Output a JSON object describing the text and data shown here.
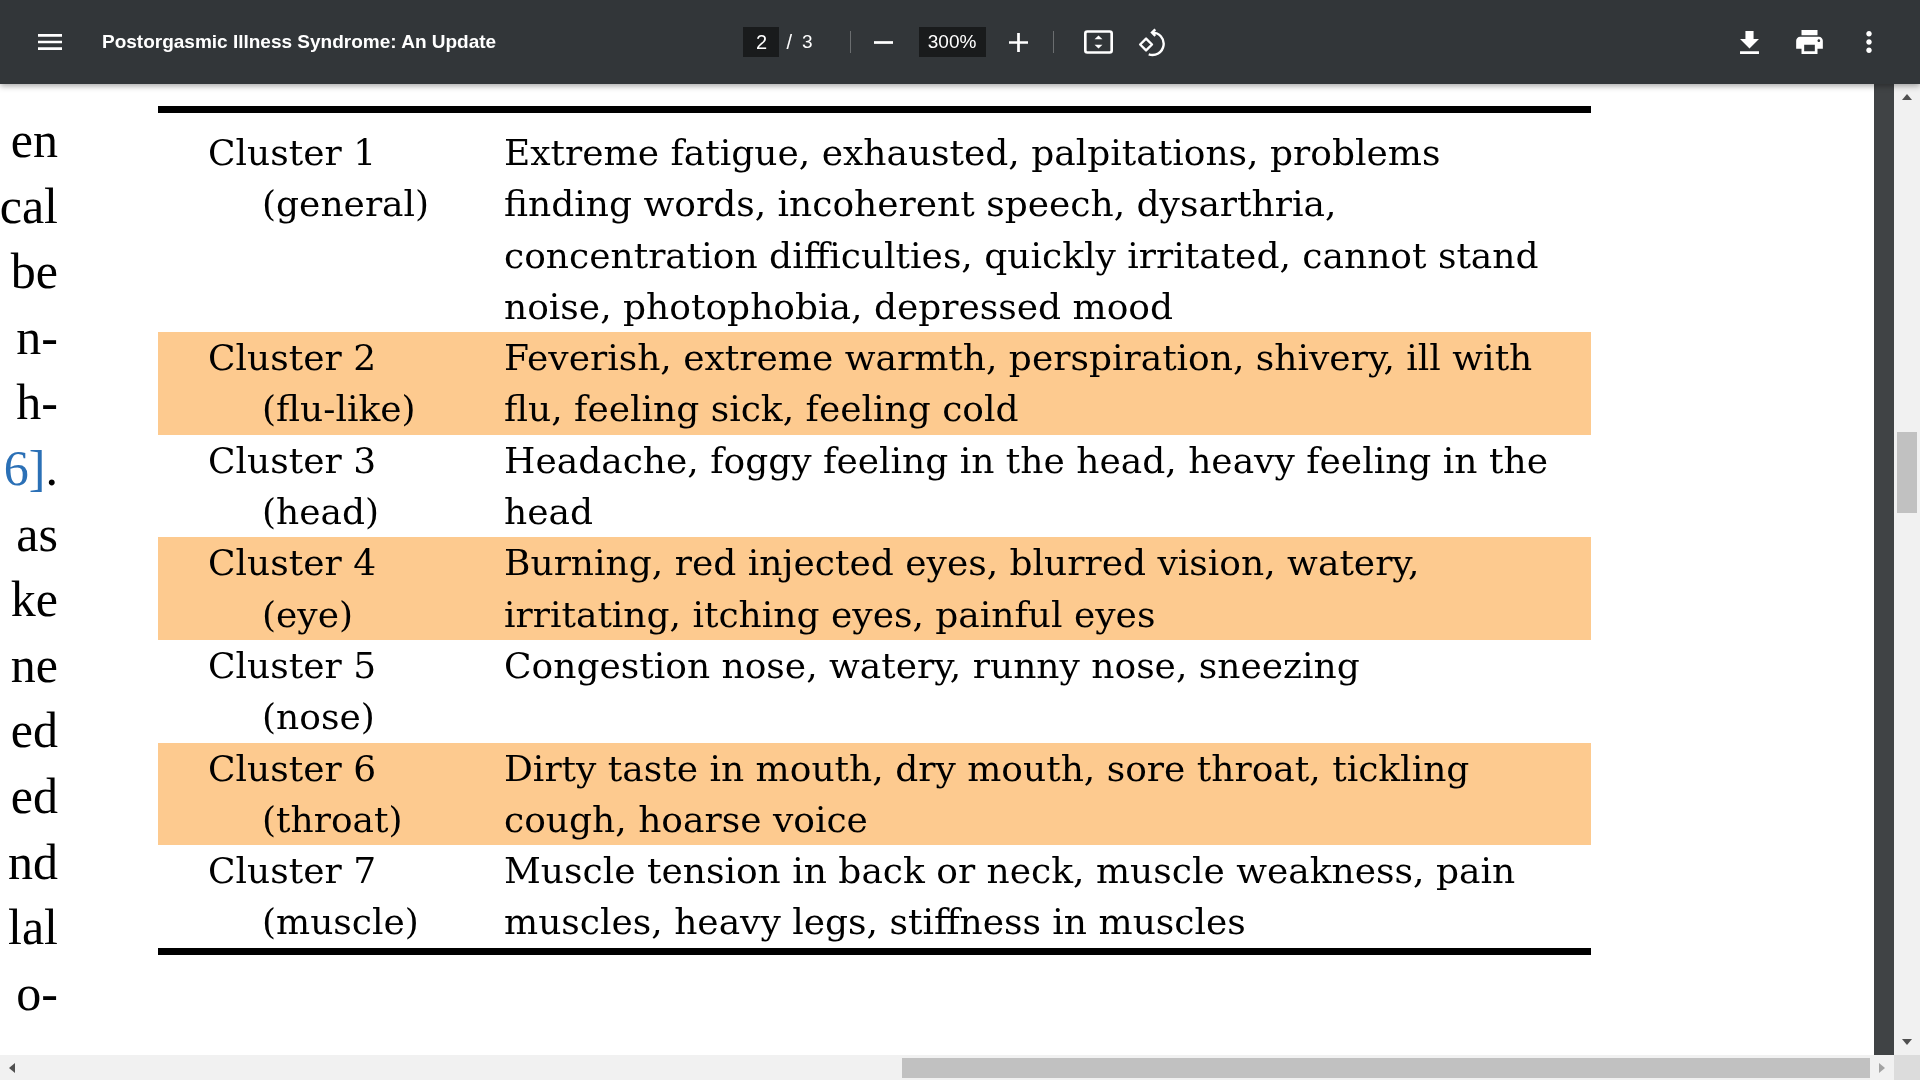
{
  "toolbar": {
    "title": "Postorgasmic Illness Syndrome: An Update",
    "page": {
      "current": "2",
      "separator": "/",
      "total": "3"
    },
    "zoom": "300%"
  },
  "body_text": [
    {
      "text": "en"
    },
    {
      "text": "cal"
    },
    {
      "text": "be"
    },
    {
      "text": "n-"
    },
    {
      "text": "h-"
    },
    {
      "link": "6]",
      "text": "."
    },
    {
      "text": "as"
    },
    {
      "text": "ke"
    },
    {
      "text": "ne"
    },
    {
      "text": "ed"
    },
    {
      "text": "ed"
    },
    {
      "text": "nd"
    },
    {
      "text": "lal"
    },
    {
      "text": "o-"
    }
  ],
  "table": {
    "rows": [
      {
        "cluster": "Cluster 1",
        "group": "(general)",
        "symptoms": "Extreme fatigue, exhausted, palpitations, problems finding words, incoherent speech, dysarthria, concentration difficulties, quickly irritated, cannot stand noise, photophobia, depressed mood",
        "shaded": false
      },
      {
        "cluster": "Cluster 2",
        "group": "(flu-like)",
        "symptoms": "Feverish, extreme warmth, perspiration, shivery, ill with flu, feeling sick, feeling cold",
        "shaded": true
      },
      {
        "cluster": "Cluster 3",
        "group": "(head)",
        "symptoms": "Headache, foggy feeling in the head, heavy feeling in the head",
        "shaded": false
      },
      {
        "cluster": "Cluster 4",
        "group": "(eye)",
        "symptoms": "Burning, red injected eyes, blurred vision, watery, irritating, itching eyes, painful eyes",
        "shaded": true
      },
      {
        "cluster": "Cluster 5",
        "group": "(nose)",
        "symptoms": "Congestion nose, watery, runny nose, sneezing",
        "shaded": false
      },
      {
        "cluster": "Cluster 6",
        "group": "(throat)",
        "symptoms": "Dirty taste in mouth, dry mouth, sore throat, tickling cough, hoarse voice",
        "shaded": true
      },
      {
        "cluster": "Cluster 7",
        "group": "(muscle)",
        "symptoms": "Muscle tension in back or neck, muscle weakness, pain muscles, heavy legs, stiffness in muscles",
        "shaded": false
      }
    ]
  }
}
